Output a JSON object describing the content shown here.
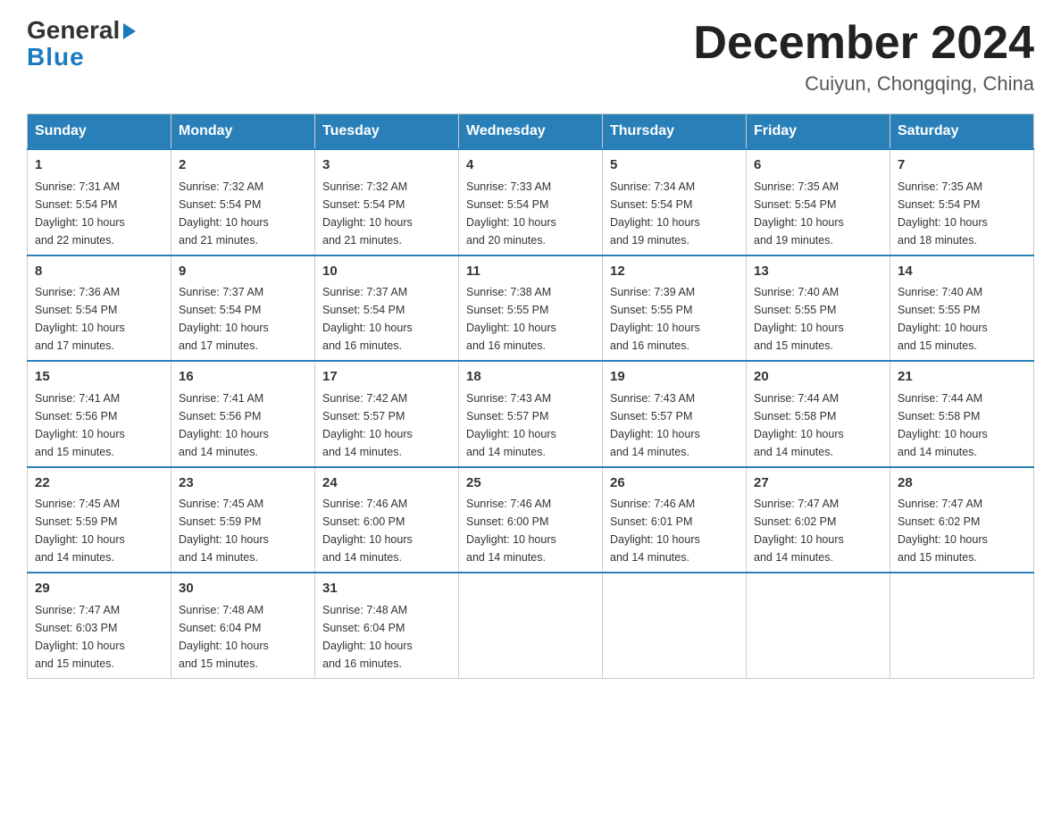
{
  "logo": {
    "part1": "General",
    "part2": "Blue"
  },
  "header": {
    "month_year": "December 2024",
    "location": "Cuiyun, Chongqing, China"
  },
  "days_of_week": [
    "Sunday",
    "Monday",
    "Tuesday",
    "Wednesday",
    "Thursday",
    "Friday",
    "Saturday"
  ],
  "weeks": [
    [
      {
        "day": "1",
        "sunrise": "7:31 AM",
        "sunset": "5:54 PM",
        "daylight": "10 hours and 22 minutes."
      },
      {
        "day": "2",
        "sunrise": "7:32 AM",
        "sunset": "5:54 PM",
        "daylight": "10 hours and 21 minutes."
      },
      {
        "day": "3",
        "sunrise": "7:32 AM",
        "sunset": "5:54 PM",
        "daylight": "10 hours and 21 minutes."
      },
      {
        "day": "4",
        "sunrise": "7:33 AM",
        "sunset": "5:54 PM",
        "daylight": "10 hours and 20 minutes."
      },
      {
        "day": "5",
        "sunrise": "7:34 AM",
        "sunset": "5:54 PM",
        "daylight": "10 hours and 19 minutes."
      },
      {
        "day": "6",
        "sunrise": "7:35 AM",
        "sunset": "5:54 PM",
        "daylight": "10 hours and 19 minutes."
      },
      {
        "day": "7",
        "sunrise": "7:35 AM",
        "sunset": "5:54 PM",
        "daylight": "10 hours and 18 minutes."
      }
    ],
    [
      {
        "day": "8",
        "sunrise": "7:36 AM",
        "sunset": "5:54 PM",
        "daylight": "10 hours and 17 minutes."
      },
      {
        "day": "9",
        "sunrise": "7:37 AM",
        "sunset": "5:54 PM",
        "daylight": "10 hours and 17 minutes."
      },
      {
        "day": "10",
        "sunrise": "7:37 AM",
        "sunset": "5:54 PM",
        "daylight": "10 hours and 16 minutes."
      },
      {
        "day": "11",
        "sunrise": "7:38 AM",
        "sunset": "5:55 PM",
        "daylight": "10 hours and 16 minutes."
      },
      {
        "day": "12",
        "sunrise": "7:39 AM",
        "sunset": "5:55 PM",
        "daylight": "10 hours and 16 minutes."
      },
      {
        "day": "13",
        "sunrise": "7:40 AM",
        "sunset": "5:55 PM",
        "daylight": "10 hours and 15 minutes."
      },
      {
        "day": "14",
        "sunrise": "7:40 AM",
        "sunset": "5:55 PM",
        "daylight": "10 hours and 15 minutes."
      }
    ],
    [
      {
        "day": "15",
        "sunrise": "7:41 AM",
        "sunset": "5:56 PM",
        "daylight": "10 hours and 15 minutes."
      },
      {
        "day": "16",
        "sunrise": "7:41 AM",
        "sunset": "5:56 PM",
        "daylight": "10 hours and 14 minutes."
      },
      {
        "day": "17",
        "sunrise": "7:42 AM",
        "sunset": "5:57 PM",
        "daylight": "10 hours and 14 minutes."
      },
      {
        "day": "18",
        "sunrise": "7:43 AM",
        "sunset": "5:57 PM",
        "daylight": "10 hours and 14 minutes."
      },
      {
        "day": "19",
        "sunrise": "7:43 AM",
        "sunset": "5:57 PM",
        "daylight": "10 hours and 14 minutes."
      },
      {
        "day": "20",
        "sunrise": "7:44 AM",
        "sunset": "5:58 PM",
        "daylight": "10 hours and 14 minutes."
      },
      {
        "day": "21",
        "sunrise": "7:44 AM",
        "sunset": "5:58 PM",
        "daylight": "10 hours and 14 minutes."
      }
    ],
    [
      {
        "day": "22",
        "sunrise": "7:45 AM",
        "sunset": "5:59 PM",
        "daylight": "10 hours and 14 minutes."
      },
      {
        "day": "23",
        "sunrise": "7:45 AM",
        "sunset": "5:59 PM",
        "daylight": "10 hours and 14 minutes."
      },
      {
        "day": "24",
        "sunrise": "7:46 AM",
        "sunset": "6:00 PM",
        "daylight": "10 hours and 14 minutes."
      },
      {
        "day": "25",
        "sunrise": "7:46 AM",
        "sunset": "6:00 PM",
        "daylight": "10 hours and 14 minutes."
      },
      {
        "day": "26",
        "sunrise": "7:46 AM",
        "sunset": "6:01 PM",
        "daylight": "10 hours and 14 minutes."
      },
      {
        "day": "27",
        "sunrise": "7:47 AM",
        "sunset": "6:02 PM",
        "daylight": "10 hours and 14 minutes."
      },
      {
        "day": "28",
        "sunrise": "7:47 AM",
        "sunset": "6:02 PM",
        "daylight": "10 hours and 15 minutes."
      }
    ],
    [
      {
        "day": "29",
        "sunrise": "7:47 AM",
        "sunset": "6:03 PM",
        "daylight": "10 hours and 15 minutes."
      },
      {
        "day": "30",
        "sunrise": "7:48 AM",
        "sunset": "6:04 PM",
        "daylight": "10 hours and 15 minutes."
      },
      {
        "day": "31",
        "sunrise": "7:48 AM",
        "sunset": "6:04 PM",
        "daylight": "10 hours and 16 minutes."
      },
      null,
      null,
      null,
      null
    ]
  ],
  "labels": {
    "sunrise": "Sunrise:",
    "sunset": "Sunset:",
    "daylight": "Daylight:"
  }
}
